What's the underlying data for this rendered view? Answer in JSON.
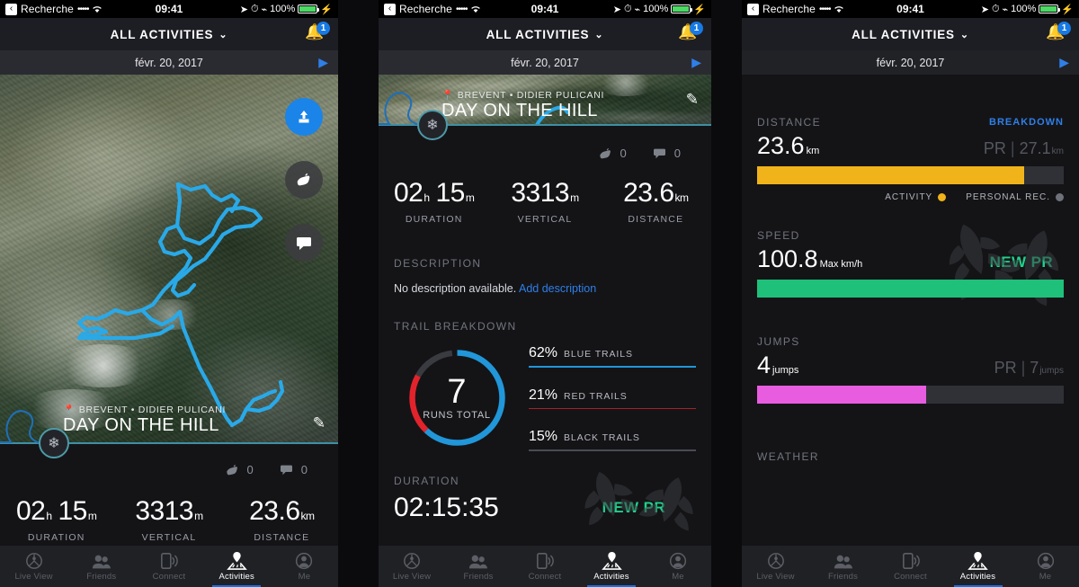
{
  "status_bar": {
    "back_icon": "chevron-left-icon",
    "carrier": "Recherche",
    "signal_dots": "•••••",
    "wifi_icon": "wifi-icon",
    "time": "09:41",
    "location_icon": "location-arrow-icon",
    "alarm_icon": "alarm-icon",
    "bluetooth_icon": "bluetooth-icon",
    "battery_pct": "100%",
    "charging_icon": "lightning-bolt-icon"
  },
  "nav": {
    "title": "ALL ACTIVITIES",
    "chevron": "⌄",
    "bell_icon": "bell-icon",
    "notification_count": "1"
  },
  "date_bar": {
    "date": "févr. 20, 2017",
    "next_icon": "play-triangle-icon"
  },
  "activity": {
    "location_pin_icon": "map-pin-icon",
    "location": "BREVENT • DIDIER PULICANI",
    "title": "DAY ON THE HILL",
    "edit_icon": "pencil-icon",
    "avatar_icon": "snowflake-icon"
  },
  "map": {
    "share_icon": "share-upload-icon",
    "like_icon": "high-five-icon",
    "comment_icon": "speech-bubble-icon",
    "track_color": "#29a9e8"
  },
  "social": {
    "likes_icon": "high-five-icon",
    "likes": "0",
    "comments_icon": "speech-bubble-icon",
    "comments": "0"
  },
  "summary_stats": [
    {
      "value": "02",
      "unit": "h",
      "value2": "15",
      "unit2": "m",
      "label": "DURATION"
    },
    {
      "value": "3313",
      "unit": "m",
      "label": "VERTICAL"
    },
    {
      "value": "23.6",
      "unit": "km",
      "label": "DISTANCE"
    }
  ],
  "description": {
    "heading": "DESCRIPTION",
    "empty_text": "No description available.",
    "add_link": "Add description"
  },
  "trail_breakdown": {
    "heading": "TRAIL BREAKDOWN",
    "total": "7",
    "total_label": "RUNS TOTAL",
    "legend": [
      {
        "pct": "62%",
        "name": "BLUE TRAILS",
        "color": "#2196d9"
      },
      {
        "pct": "21%",
        "name": "RED TRAILS",
        "color": "#e3232b"
      },
      {
        "pct": "15%",
        "name": "BLACK TRAILS",
        "color": "#3a3b41"
      }
    ]
  },
  "duration_section": {
    "heading": "DURATION",
    "value": "02:15:35",
    "new_pr": "NEW PR"
  },
  "metrics": [
    {
      "heading": "DISTANCE",
      "link": "BREAKDOWN",
      "value": "23.6",
      "unit": "km",
      "pr_label": "PR",
      "pr_value": "27.1",
      "pr_unit": "km",
      "fill_pct": 87,
      "fill_color": "#f0b31a",
      "legend": [
        {
          "label": "ACTIVITY",
          "color": "#f0b31a"
        },
        {
          "label": "PERSONAL REC.",
          "color": "#6e7179"
        }
      ]
    },
    {
      "heading": "SPEED",
      "value": "100.8",
      "unit": "Max km/h",
      "fill_pct": 100,
      "fill_color": "#1fc07a",
      "new_pr": "NEW PR"
    },
    {
      "heading": "JUMPS",
      "value": "4",
      "unit": "jumps",
      "pr_label": "PR",
      "pr_value": "7",
      "pr_unit": "jumps",
      "fill_pct": 55,
      "fill_color": "#e85ce0"
    }
  ],
  "weather": {
    "heading": "WEATHER"
  },
  "tab_bar": {
    "items": [
      {
        "label": "Live View",
        "icon": "live-view-icon",
        "active": false
      },
      {
        "label": "Friends",
        "icon": "friends-icon",
        "active": false
      },
      {
        "label": "Connect",
        "icon": "connect-icon",
        "active": false
      },
      {
        "label": "Activities",
        "icon": "activities-pin-icon",
        "active": true
      },
      {
        "label": "Me",
        "icon": "person-icon",
        "active": false
      }
    ],
    "active_color": "#1a6fe0"
  }
}
